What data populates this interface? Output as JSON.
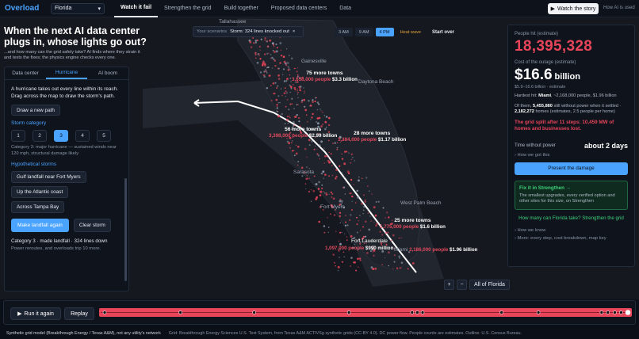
{
  "nav": {
    "brand": "Overload",
    "state": "Florida",
    "links": [
      "Watch it fail",
      "Strengthen the grid",
      "Build together",
      "Proposed data centers",
      "Data"
    ],
    "watch_story": "Watch the story",
    "ai_used": "How AI is used"
  },
  "hero": {
    "title": "When the next AI data center plugs in, whose lights go out?",
    "subtitle": "...and how many can the grid safely take? AI finds where they strain it and tests the fixes; the physics engine checks every one."
  },
  "left": {
    "tabs": [
      "Data center",
      "Hurricane",
      "AI boom"
    ],
    "description": "A hurricane takes out every line within its reach. Drag across the map to draw the storm's path.",
    "draw_path": "Draw a new path",
    "storm_category_title": "Storm category",
    "categories": [
      "1",
      "2",
      "3",
      "4",
      "5"
    ],
    "selected_category": "3",
    "category_note": "Category 3: major hurricane — sustained winds near 120 mph, structural damage likely",
    "hypothetical_title": "Hypothetical storms",
    "storms": [
      "Gulf landfall near Fort Myers",
      "Up the Atlantic coast",
      "Across Tampa Bay"
    ],
    "make_landfall": "Make landfall again",
    "clear_storm": "Clear storm",
    "summary": "Category 3 · made landfall · 324 lines down",
    "summary2": "Power reroutes, and overloads trip 10 more."
  },
  "scenario": {
    "label": "Your scenarios",
    "value": "Storm: 324 lines knocked out",
    "close": "×",
    "times": [
      "3 AM",
      "9 AM",
      "4 PM",
      "Heat wave"
    ],
    "active_time": "4 PM",
    "start_over": "Start over"
  },
  "map": {
    "cities": [
      "Tallahassee",
      "Gainesville",
      "Daytona Beach",
      "Sarasota",
      "Fort Myers",
      "West Palm Beach",
      "Fort Lauderdale",
      "Miami"
    ],
    "clusters": [
      {
        "towns": "75 more towns",
        "people": "3,658,000 people",
        "cost": "$3.3 billion"
      },
      {
        "towns": "56 more towns",
        "people": "3,398,000 people",
        "cost": "$2.99 billion"
      },
      {
        "towns": "28 more towns",
        "people": "1,384,000 people",
        "cost": "$1.17 billion"
      },
      {
        "towns": "25 more towns",
        "people": "1,775,000 people",
        "cost": "$1.6 billion"
      },
      {
        "towns": "",
        "people": "1,097,000 people",
        "cost": "$990 million"
      },
      {
        "towns": "",
        "people": "2,186,000 people",
        "cost": "$1.96 billion"
      }
    ],
    "zoom_in": "+",
    "zoom_out": "−",
    "extent": "All of Florida"
  },
  "right": {
    "people_label": "People hit (estimate)",
    "people_value": "18,395,328",
    "cost_label": "Cost of the outage (estimate)",
    "cost_value": "$16.6",
    "cost_unit": "billion",
    "cost_range": "$5.9–16.6 billion · estimate",
    "hardest_hit_prefix": "Hardest hit: ",
    "hardest_hit_city": "Miami",
    "hardest_hit_rest": ", ~2,168,000 people, $1.96 billion",
    "still_without_1": "Of them, ",
    "still_without_num": "5,455,880",
    "still_without_2": " still without power when it settled · ",
    "still_homes_num": "2,182,272",
    "still_without_3": " homes (estimates, 2.5 people per home)",
    "split_text": "The grid split after 11 steps: 10,459 MW of homes and businesses lost.",
    "time_label": "Time without power",
    "time_value": "about 2 days",
    "how_got": "› How we got this",
    "present": "Present the damage",
    "fix_head": "Fix it in Strengthen →",
    "fix_body": "The smallest upgrades, every verified option and other sites for this size, on Strengthen",
    "how_many": "How many can Florida take? Strengthen the grid",
    "how_know": "› How we know",
    "more": "› More: every step, cost breakdown, map key"
  },
  "timeline": {
    "run_again": "Run it again",
    "replay": "Replay",
    "progress": 1.0
  },
  "footer": {
    "left": "Synthetic grid model (Breakthrough Energy / Texas A&M), not any utility's network",
    "right": "Grid: Breakthrough Energy Sciences U.S. Test System, from Texas A&M ACTIVSg synthetic grids (CC-BY 4.0). DC power flow. People counts are estimates. Outline: U.S. Census Bureau."
  },
  "colors": {
    "accent": "#4aa3ff",
    "danger": "#e8455a",
    "success": "#3fd07a",
    "warn": "#e6a23c"
  }
}
